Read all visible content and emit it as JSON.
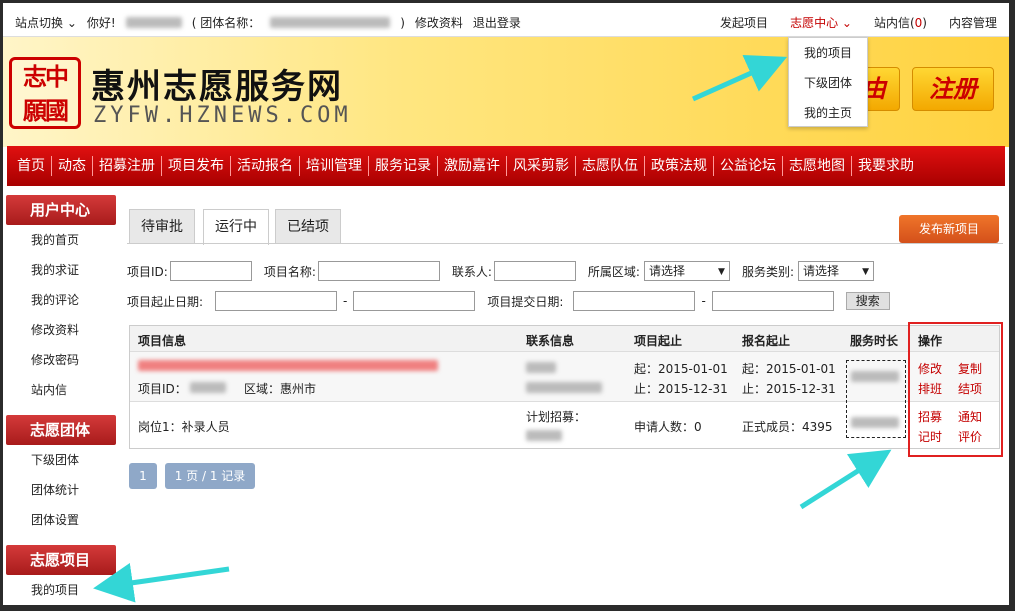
{
  "topbar": {
    "site_switch": "站点切换",
    "hello": "你好!",
    "team_prefix": "( 团体名称：",
    "team_suffix": ")",
    "edit_profile": "修改资料",
    "logout": "退出登录",
    "launch_project": "发起项目",
    "volunteer_center": "志愿中心",
    "inbox_label": "站内信(",
    "inbox_count": "0",
    "inbox_close": ")",
    "content_admin": "内容管理"
  },
  "dropdown": {
    "items": [
      "我的项目",
      "下级团体",
      "我的主页"
    ]
  },
  "header": {
    "seal_text": "志中願國",
    "site_title": "惠州志愿服务网",
    "site_url": "ZYFW.HZNEWS.COM",
    "login_partial": "由",
    "register": "注册"
  },
  "nav": {
    "items": [
      "首页",
      "动态",
      "招募注册",
      "项目发布",
      "活动报名",
      "培训管理",
      "服务记录",
      "激励嘉许",
      "风采剪影",
      "志愿队伍",
      "政策法规",
      "公益论坛",
      "志愿地图",
      "我要求助"
    ]
  },
  "sidebar": {
    "user_center": "用户中心",
    "user_items": [
      "我的首页",
      "我的求证",
      "我的评论",
      "修改资料",
      "修改密码",
      "站内信"
    ],
    "team_header": "志愿团体",
    "team_items": [
      "下级团体",
      "团体统计",
      "团体设置"
    ],
    "project_header": "志愿项目",
    "project_items": [
      "我的项目"
    ]
  },
  "tabs": [
    "待审批",
    "运行中",
    "已结项"
  ],
  "publish_button": "发布新项目",
  "filters": {
    "project_id": "项目ID:",
    "project_name": "项目名称:",
    "contact": "联系人:",
    "region": "所属区域:",
    "region_value": "请选择",
    "category": "服务类别:",
    "category_value": "请选择",
    "start_end_date": "项目起止日期:",
    "submit_date": "项目提交日期:",
    "dash": "-",
    "search": "搜索"
  },
  "table": {
    "headers": [
      "项目信息",
      "联系信息",
      "项目起止",
      "报名起止",
      "服务时长",
      "操作"
    ],
    "row1": {
      "id_label": "项目ID：",
      "region_label": "区域：",
      "region_value": "惠州市",
      "project_start": "起：2015-01-01",
      "project_end": "止：2015-12-31",
      "signup_start": "起：2015-01-01",
      "signup_end": "止：2015-12-31",
      "ops": [
        "修改",
        "复制",
        "排班",
        "结项"
      ]
    },
    "row2": {
      "post": "岗位1：补录人员",
      "plan_recruit": "计划招募：",
      "applicants": "申请人数：0",
      "members": "正式成员：4395",
      "ops": [
        "招募",
        "通知",
        "记时",
        "评价"
      ]
    }
  },
  "pagination": {
    "page": "1",
    "summary": "1 页 / 1 记录"
  },
  "colors": {
    "nav_red": "#c40000",
    "annotation_arrow": "#33d6d6",
    "highlight_box": "#e02020"
  }
}
